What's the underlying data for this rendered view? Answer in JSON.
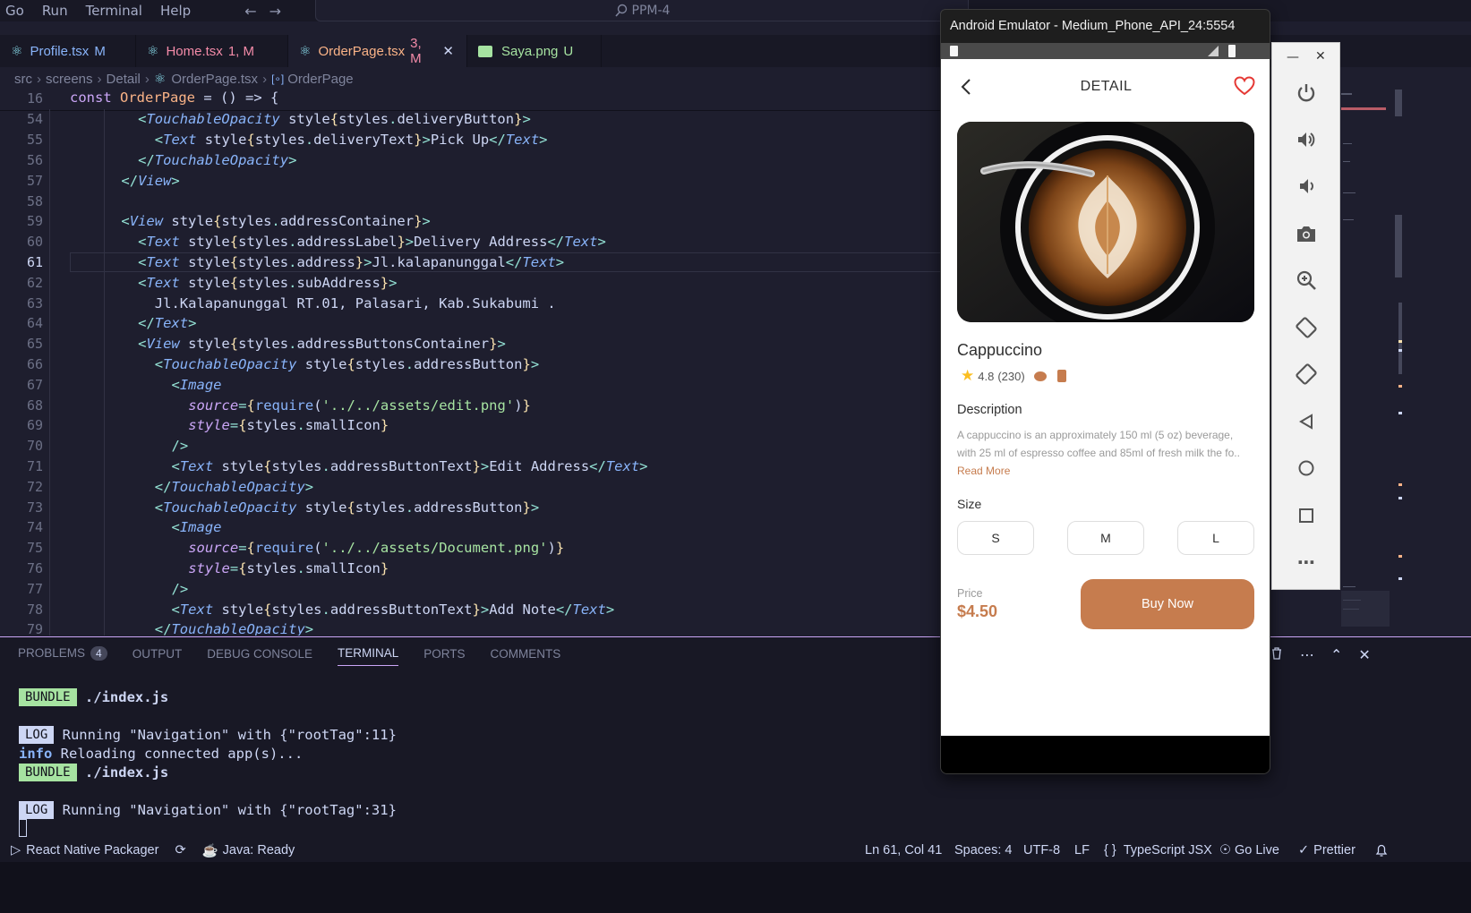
{
  "menu": [
    "Go",
    "Run",
    "Terminal",
    "Help"
  ],
  "search": {
    "label": "PPM-4"
  },
  "tabs": [
    {
      "name": "Profile.tsx",
      "state": "M"
    },
    {
      "name": "Home.tsx",
      "state": "1, M"
    },
    {
      "name": "OrderPage.tsx",
      "state": "3, M"
    },
    {
      "name": "Saya.png",
      "state": "U"
    }
  ],
  "breadcrumb": [
    "src",
    "screens",
    "Detail",
    "OrderPage.tsx",
    "OrderPage"
  ],
  "sticky": {
    "line_no": "16",
    "code": "const OrderPage = () => {"
  },
  "code": [
    {
      "n": "54",
      "indent": 4,
      "text": "<TouchableOpacity style={styles.deliveryButton}>"
    },
    {
      "n": "55",
      "indent": 5,
      "text": "<Text style={styles.deliveryText}>Pick Up</Text>"
    },
    {
      "n": "56",
      "indent": 4,
      "text": "</TouchableOpacity>"
    },
    {
      "n": "57",
      "indent": 3,
      "text": "</View>"
    },
    {
      "n": "58",
      "indent": 0,
      "text": ""
    },
    {
      "n": "59",
      "indent": 3,
      "text": "<View style={styles.addressContainer}>"
    },
    {
      "n": "60",
      "indent": 4,
      "text": "<Text style={styles.addressLabel}>Delivery Address</Text>"
    },
    {
      "n": "61",
      "indent": 4,
      "text": "<Text style={styles.address}>Jl.kalapanunggal</Text>"
    },
    {
      "n": "62",
      "indent": 4,
      "text": "<Text style={styles.subAddress}>"
    },
    {
      "n": "63",
      "indent": 5,
      "text": "Jl.Kalapanunggal RT.01, Palasari, Kab.Sukabumi ."
    },
    {
      "n": "64",
      "indent": 4,
      "text": "</Text>"
    },
    {
      "n": "65",
      "indent": 4,
      "text": "<View style={styles.addressButtonsContainer}>"
    },
    {
      "n": "66",
      "indent": 5,
      "text": "<TouchableOpacity style={styles.addressButton}>"
    },
    {
      "n": "67",
      "indent": 6,
      "text": "<Image"
    },
    {
      "n": "68",
      "indent": 7,
      "text": "source={require('../../assets/edit.png')}"
    },
    {
      "n": "69",
      "indent": 7,
      "text": "style={styles.smallIcon}"
    },
    {
      "n": "70",
      "indent": 6,
      "text": "/>"
    },
    {
      "n": "71",
      "indent": 6,
      "text": "<Text style={styles.addressButtonText}>Edit Address</Text>"
    },
    {
      "n": "72",
      "indent": 5,
      "text": "</TouchableOpacity>"
    },
    {
      "n": "73",
      "indent": 5,
      "text": "<TouchableOpacity style={styles.addressButton}>"
    },
    {
      "n": "74",
      "indent": 6,
      "text": "<Image"
    },
    {
      "n": "75",
      "indent": 7,
      "text": "source={require('../../assets/Document.png')}"
    },
    {
      "n": "76",
      "indent": 7,
      "text": "style={styles.smallIcon}"
    },
    {
      "n": "77",
      "indent": 6,
      "text": "/>"
    },
    {
      "n": "78",
      "indent": 6,
      "text": "<Text style={styles.addressButtonText}>Add Note</Text>"
    },
    {
      "n": "79",
      "indent": 5,
      "text": "</TouchableOpacity>"
    }
  ],
  "panel": {
    "tabs": [
      "PROBLEMS",
      "OUTPUT",
      "DEBUG CONSOLE",
      "TERMINAL",
      "PORTS",
      "COMMENTS"
    ],
    "problems_count": "4",
    "terminal": [
      {
        "tag": "BUNDLE",
        "text": " ./index.js"
      },
      {
        "tag": "LOG",
        "text": " Running \"Navigation\" with {\"rootTag\":11}"
      },
      {
        "info": "info",
        "text": " Reloading connected app(s)..."
      },
      {
        "tag": "BUNDLE",
        "text": " ./index.js"
      },
      {
        "tag": "LOG",
        "text": " Running \"Navigation\" with {\"rootTag\":31}"
      }
    ]
  },
  "statusbar": {
    "packager": "React Native Packager",
    "java": "Java: Ready",
    "position": "Ln 61, Col 41",
    "spaces": "Spaces: 4",
    "encoding": "UTF-8",
    "eol": "LF",
    "language": "TypeScript JSX",
    "golive": "Go Live",
    "prettier": "Prettier"
  },
  "emulator": {
    "title": "Android Emulator - Medium_Phone_API_24:5554",
    "screen_title": "DETAIL",
    "product_name": "Cappuccino",
    "rating": "4.8",
    "reviews": "(230)",
    "description_label": "Description",
    "description": "A cappuccino is an approximately 150 ml (5 oz) beverage, with 25 ml of espresso coffee and 85ml of fresh milk the fo..",
    "read_more": "Read More",
    "size_label": "Size",
    "sizes": [
      "S",
      "M",
      "L"
    ],
    "price_label": "Price",
    "price": "$4.50",
    "buy_label": "Buy Now",
    "accent": "#c67c4e"
  },
  "colors": {
    "editor_bg": "#1e1e2e",
    "panel_accent": "#cba6f7",
    "heart": "#e53935"
  }
}
